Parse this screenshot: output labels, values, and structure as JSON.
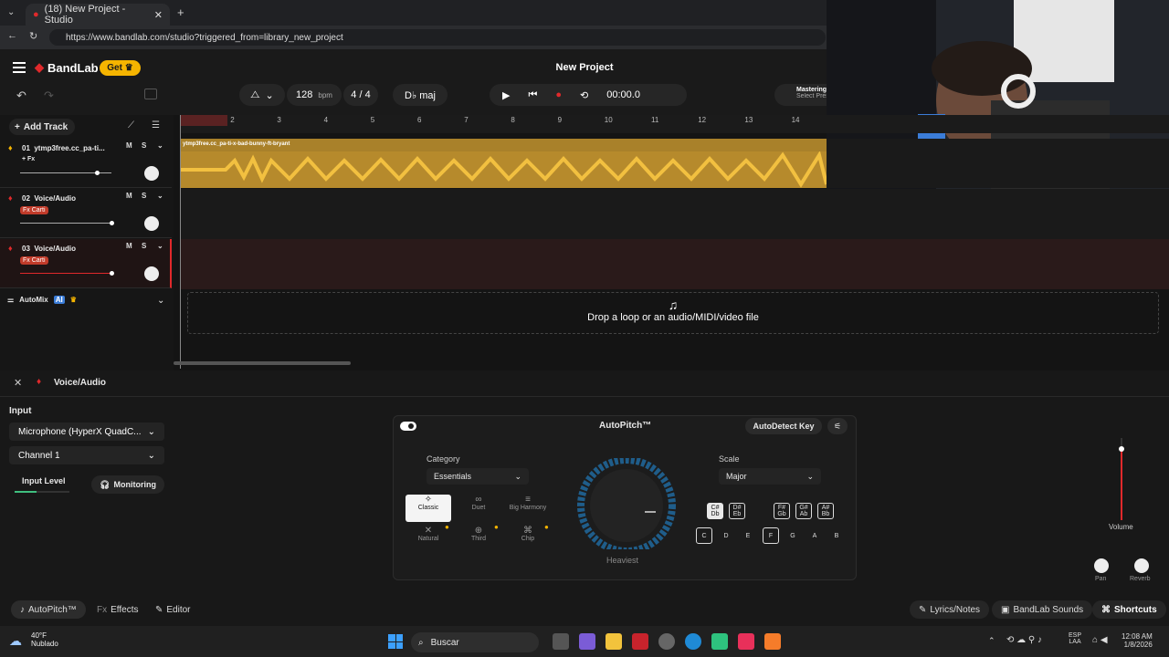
{
  "browser": {
    "tab_title": "(18) New Project - Studio",
    "url": "https://www.bandlab.com/studio?triggered_from=library_new_project"
  },
  "header": {
    "logo": "BandLab",
    "get_label": "Get",
    "project_title": "New Project",
    "tempo": "128",
    "tempo_unit": "bpm",
    "time_sig": "4 / 4",
    "key": "D♭ maj",
    "time": "00:00.0",
    "mastering": "Mastering",
    "mastering_sub": "Select Preset"
  },
  "tracks_panel": {
    "add_track": "Add Track",
    "tracks": [
      {
        "num": "01",
        "name": "ytmp3free.cc_pa-ti...",
        "fx": "+ Fx",
        "mute": "M",
        "solo": "S"
      },
      {
        "num": "02",
        "name": "Voice/Audio",
        "fx": "Fx Carti",
        "mute": "M",
        "solo": "S"
      },
      {
        "num": "03",
        "name": "Voice/Audio",
        "fx": "Fx Carti",
        "mute": "M",
        "solo": "S"
      }
    ],
    "automix": "AutoMix",
    "ai_badge": "AI"
  },
  "timeline": {
    "bars": [
      "1",
      "2",
      "3",
      "4",
      "5",
      "6",
      "7",
      "8",
      "9",
      "10",
      "11",
      "12",
      "13",
      "14"
    ],
    "clip_name": "ytmp3free.cc_pa-ti-x-bad-bunny-ft-bryant",
    "drop_text": "Drop a loop or an audio/MIDI/video file"
  },
  "panel": {
    "track_title": "Voice/Audio",
    "input_label": "Input",
    "mic": "Microphone (HyperX QuadC...",
    "channel": "Channel 1",
    "input_level": "Input Level",
    "monitoring": "Monitoring",
    "autopitch_title": "AutoPitch™",
    "autodetect": "AutoDetect Key",
    "category_label": "Category",
    "category_value": "Essentials",
    "modes": [
      "Classic",
      "Duet",
      "Big Harmony",
      "Natural",
      "Third",
      "Chip"
    ],
    "heaviest": "Heaviest",
    "scale_label": "Scale",
    "scale_value": "Major",
    "sharps": [
      "C#\nDb",
      "D#\nEb",
      "F#\nGb",
      "G#\nAb",
      "A#\nBb"
    ],
    "naturals": [
      "C",
      "D",
      "E",
      "F",
      "G",
      "A",
      "B"
    ],
    "volume": "Volume",
    "pan": "Pan",
    "reverb": "Reverb"
  },
  "bottom": {
    "autopitch": "AutoPitch™",
    "effects": "Effects",
    "editor": "Editor",
    "lyrics": "Lyrics/Notes",
    "sounds": "BandLab Sounds",
    "shortcuts": "Shortcuts"
  },
  "taskbar": {
    "temp": "40°F",
    "weather": "Nublado",
    "search": "Buscar",
    "lang1": "ESP",
    "lang2": "LAA",
    "clock": "12:08 AM",
    "date": "1/8/2026"
  },
  "colors": {
    "accent": "#f5b400",
    "record": "#e0292b",
    "clip": "#c99a2e"
  }
}
